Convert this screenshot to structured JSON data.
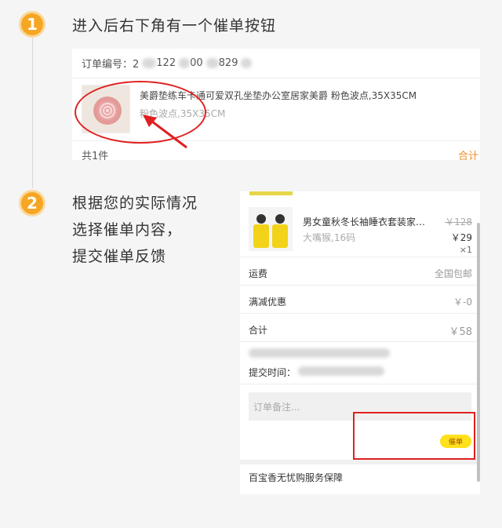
{
  "steps": {
    "step1": {
      "number": "1",
      "title": "进入后右下角有一个催单按钮"
    },
    "step2": {
      "number": "2",
      "lines": [
        "根据您的实际情况",
        "选择催单内容，",
        "提交催单反馈"
      ]
    }
  },
  "card1": {
    "order_no_label": "订单编号：2",
    "order_no_partial": "122",
    "order_no_partial2": "00",
    "order_no_partial3": "829",
    "product_title": "美爵垫练车卡通可爱双孔坐垫办公室居家美爵 粉色波点,35X35CM",
    "product_spec": "粉色波点,35X35CM",
    "count": "共1件",
    "total_label": "合计"
  },
  "card2": {
    "product_title": "男女童秋冬长袖睡衣套装家…",
    "product_spec": "大嘴猴,16码",
    "old_price": "￥128",
    "price": "￥29",
    "qty": "×1",
    "rows": [
      {
        "label": "运费",
        "value": "全国包邮"
      },
      {
        "label": "满减优惠",
        "value": "￥-0"
      },
      {
        "label": "合计",
        "value": "￥58"
      }
    ],
    "submit_time_label": "提交时间：",
    "remark_placeholder": "订单备注...",
    "urge_button": "催单",
    "service": "百宝香无忧购服务保障"
  },
  "colors": {
    "accent": "#f5a623",
    "highlight": "#e02020",
    "urge_button": "#ffe11c"
  }
}
